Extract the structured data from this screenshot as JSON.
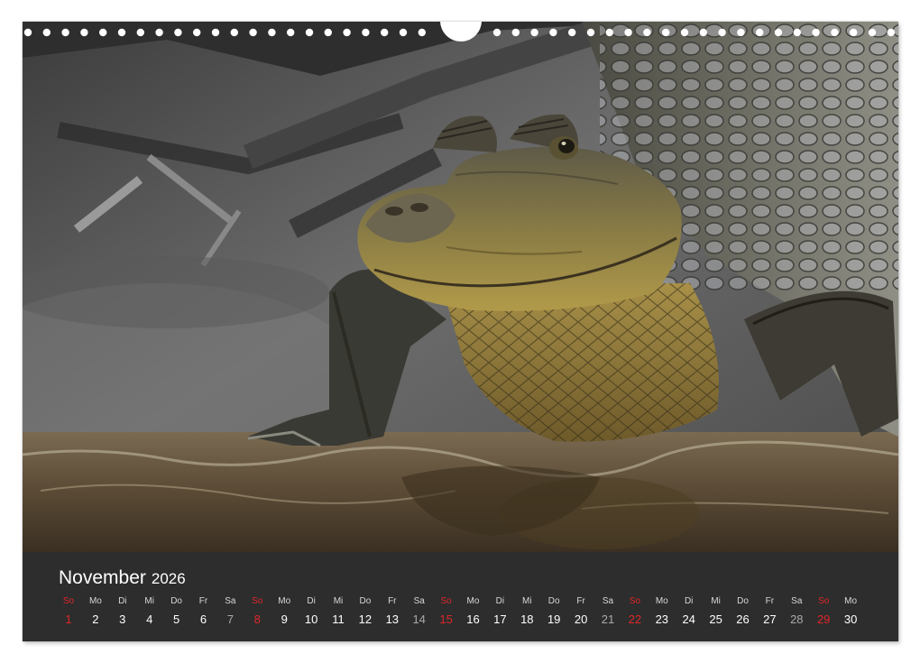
{
  "calendar": {
    "month": "November",
    "year": "2026",
    "days": [
      {
        "wd": "So",
        "d": "1",
        "kind": "sun"
      },
      {
        "wd": "Mo",
        "d": "2",
        "kind": "wk"
      },
      {
        "wd": "Di",
        "d": "3",
        "kind": "wk"
      },
      {
        "wd": "Mi",
        "d": "4",
        "kind": "wk"
      },
      {
        "wd": "Do",
        "d": "5",
        "kind": "wk"
      },
      {
        "wd": "Fr",
        "d": "6",
        "kind": "wk"
      },
      {
        "wd": "Sa",
        "d": "7",
        "kind": "sat"
      },
      {
        "wd": "So",
        "d": "8",
        "kind": "sun"
      },
      {
        "wd": "Mo",
        "d": "9",
        "kind": "wk"
      },
      {
        "wd": "Di",
        "d": "10",
        "kind": "wk"
      },
      {
        "wd": "Mi",
        "d": "11",
        "kind": "wk"
      },
      {
        "wd": "Do",
        "d": "12",
        "kind": "wk"
      },
      {
        "wd": "Fr",
        "d": "13",
        "kind": "wk"
      },
      {
        "wd": "Sa",
        "d": "14",
        "kind": "sat"
      },
      {
        "wd": "So",
        "d": "15",
        "kind": "sun"
      },
      {
        "wd": "Mo",
        "d": "16",
        "kind": "wk"
      },
      {
        "wd": "Di",
        "d": "17",
        "kind": "wk"
      },
      {
        "wd": "Mi",
        "d": "18",
        "kind": "wk"
      },
      {
        "wd": "Do",
        "d": "19",
        "kind": "wk"
      },
      {
        "wd": "Fr",
        "d": "20",
        "kind": "wk"
      },
      {
        "wd": "Sa",
        "d": "21",
        "kind": "sat"
      },
      {
        "wd": "So",
        "d": "22",
        "kind": "sun"
      },
      {
        "wd": "Mo",
        "d": "23",
        "kind": "wk"
      },
      {
        "wd": "Di",
        "d": "24",
        "kind": "wk"
      },
      {
        "wd": "Mi",
        "d": "25",
        "kind": "wk"
      },
      {
        "wd": "Do",
        "d": "26",
        "kind": "wk"
      },
      {
        "wd": "Fr",
        "d": "27",
        "kind": "wk"
      },
      {
        "wd": "Sa",
        "d": "28",
        "kind": "sat"
      },
      {
        "wd": "So",
        "d": "29",
        "kind": "sun"
      },
      {
        "wd": "Mo",
        "d": "30",
        "kind": "wk"
      }
    ]
  },
  "colors": {
    "sunday": "#e0262a",
    "saturday": "#a9a9a9",
    "bar": "#2d2d2d"
  },
  "photo": {
    "icon": "caiman-photo"
  }
}
